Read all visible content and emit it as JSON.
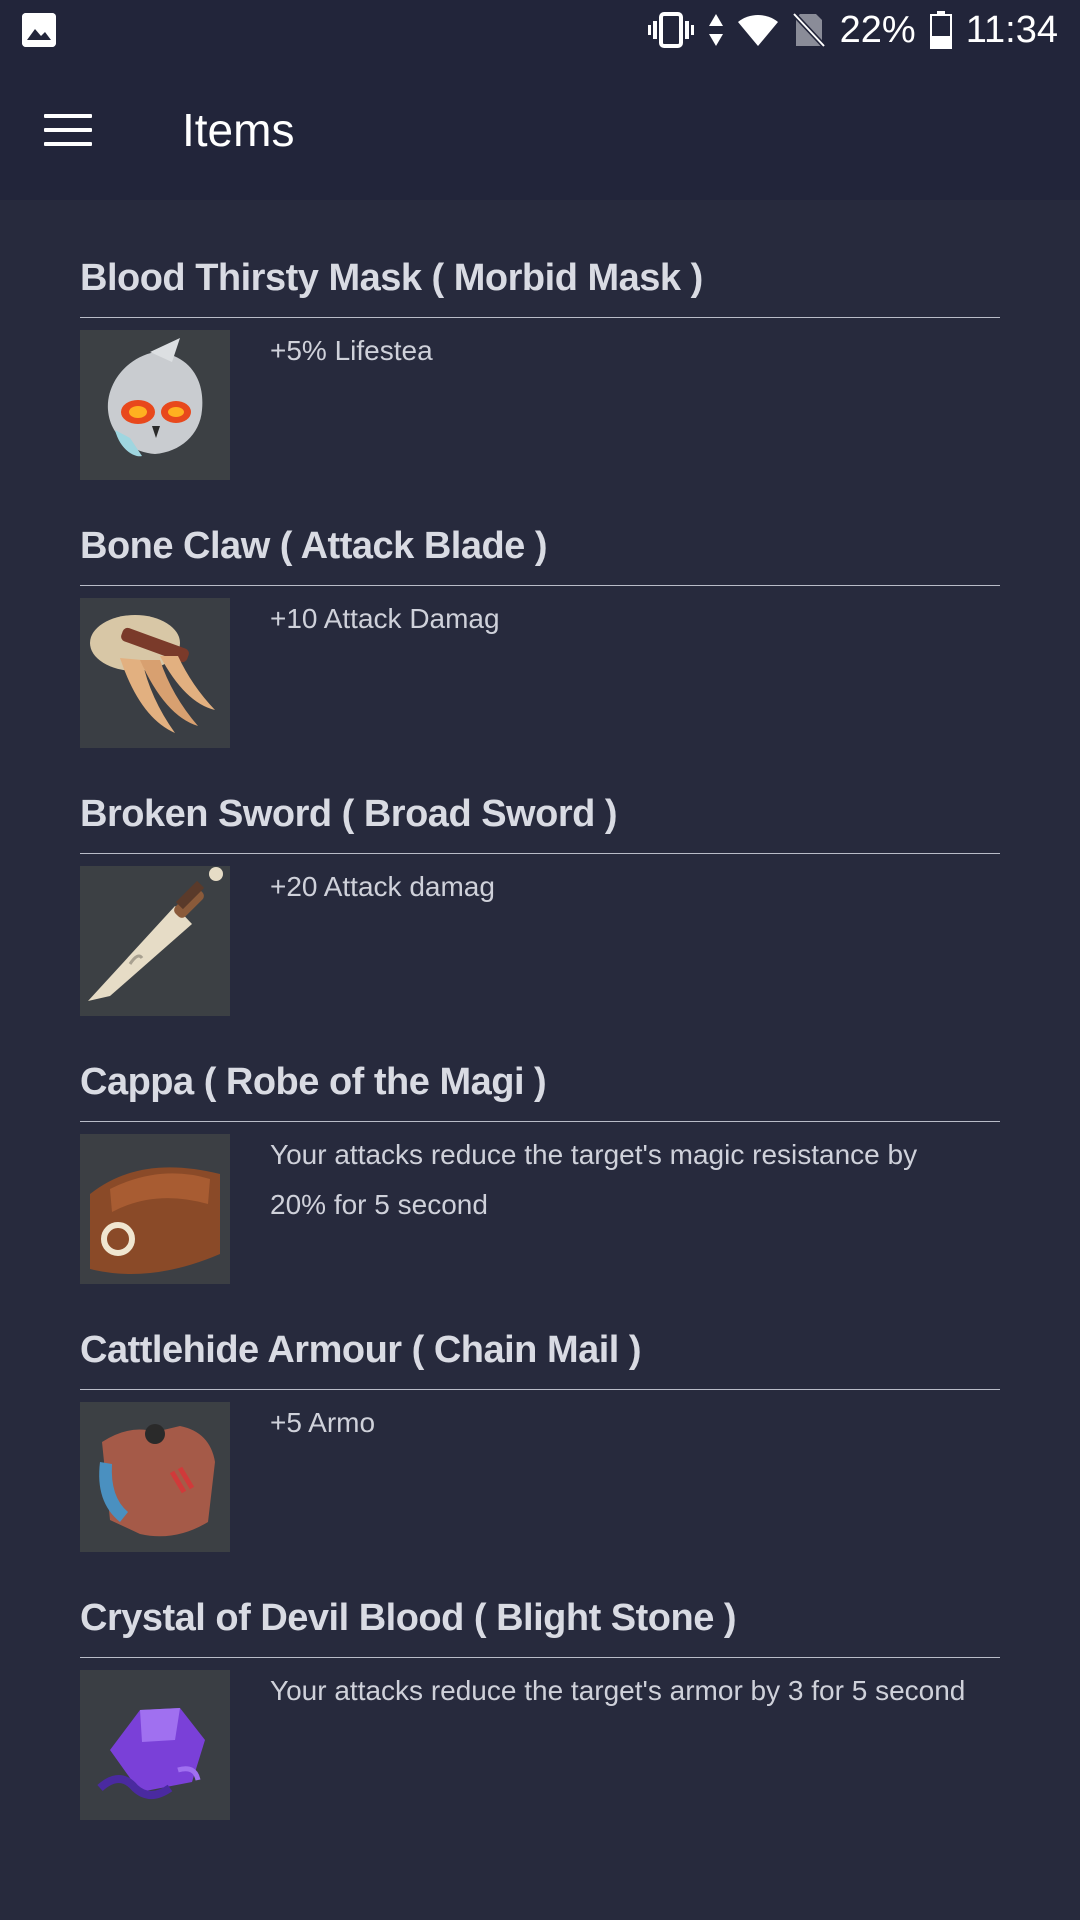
{
  "status": {
    "battery": "22%",
    "time": "11:34"
  },
  "appbar": {
    "title": "Items"
  },
  "items": [
    {
      "title": "Blood Thirsty Mask ( Morbid Mask )",
      "desc": "+5% Lifestea",
      "icon": "mask-icon"
    },
    {
      "title": "Bone Claw ( Attack Blade )",
      "desc": "+10 Attack Damag",
      "icon": "claw-icon"
    },
    {
      "title": "Broken Sword ( Broad Sword )",
      "desc": "+20 Attack damag",
      "icon": "sword-icon"
    },
    {
      "title": "Cappa ( Robe of the Magi )",
      "desc": "Your attacks reduce the target's magic resistance by 20% for 5 second",
      "icon": "cape-icon"
    },
    {
      "title": "Cattlehide Armour ( Chain Mail )",
      "desc": "+5 Armo",
      "icon": "armor-icon"
    },
    {
      "title": "Crystal of Devil Blood ( Blight Stone )",
      "desc": "Your attacks reduce the target's armor by 3 for 5 second",
      "icon": "crystal-icon"
    }
  ]
}
